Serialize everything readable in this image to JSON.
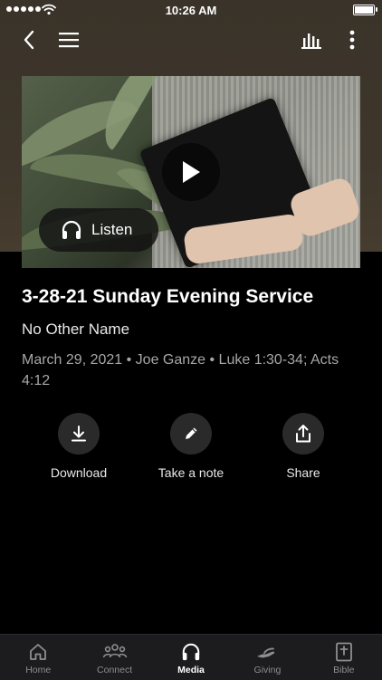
{
  "status_bar": {
    "time": "10:26 AM"
  },
  "nav": {
    "back_icon": "chevron-left-icon",
    "menu_icon": "hamburger-icon",
    "audio_icon": "bars-icon",
    "more_icon": "vertical-ellipsis-icon"
  },
  "media": {
    "listen_label": "Listen",
    "title": "3-28-21 Sunday Evening Service",
    "subtitle": "No Other Name",
    "meta": "March 29, 2021 • Joe Ganze • Luke 1:30-34; Acts 4:12"
  },
  "actions": [
    {
      "label": "Download",
      "icon": "download-icon"
    },
    {
      "label": "Take a note",
      "icon": "pencil-icon"
    },
    {
      "label": "Share",
      "icon": "share-icon"
    }
  ],
  "tabs": [
    {
      "label": "Home",
      "icon": "home-icon"
    },
    {
      "label": "Connect",
      "icon": "people-icon"
    },
    {
      "label": "Media",
      "icon": "headphones-icon",
      "active": true
    },
    {
      "label": "Giving",
      "icon": "hand-icon"
    },
    {
      "label": "Bible",
      "icon": "bible-icon"
    }
  ]
}
